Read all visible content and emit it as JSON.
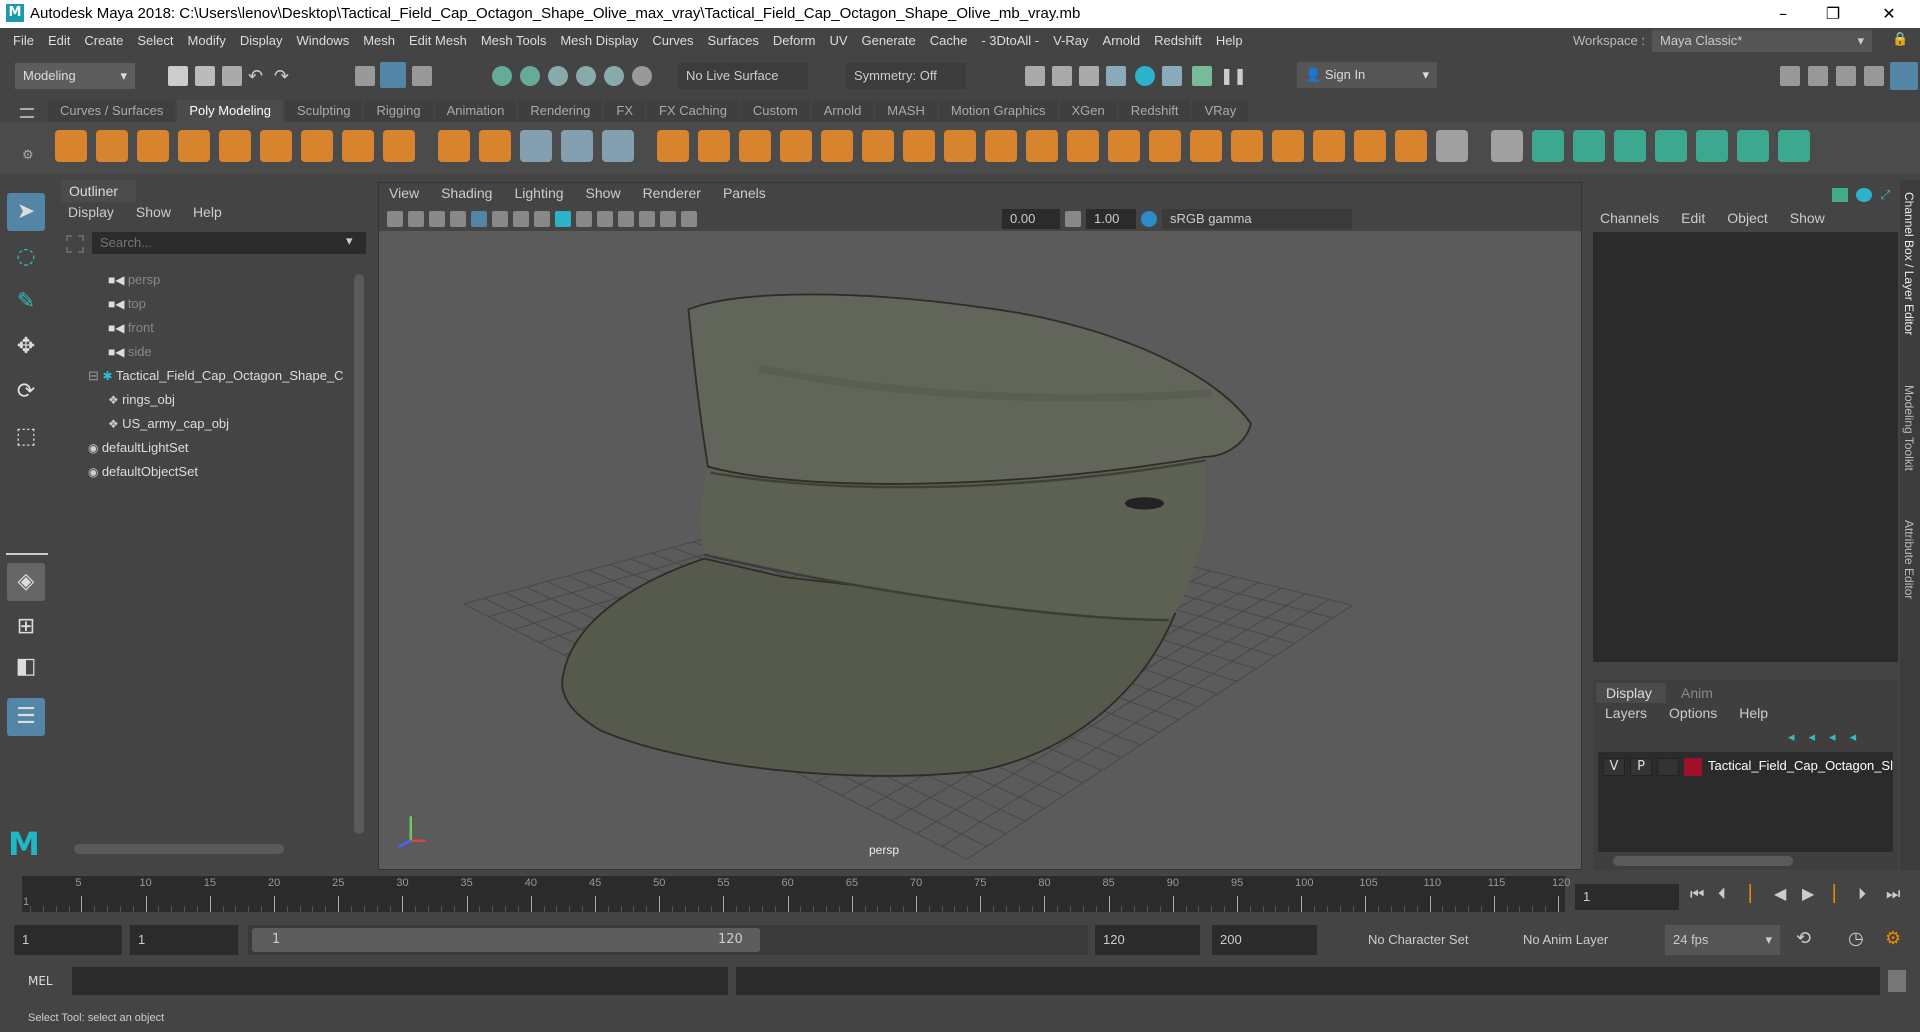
{
  "title": "Autodesk Maya 2018: C:\\Users\\lenov\\Desktop\\Tactical_Field_Cap_Octagon_Shape_Olive_max_vray\\Tactical_Field_Cap_Octagon_Shape_Olive_mb_vray.mb",
  "logo": "M",
  "window_controls": {
    "minimize": "–",
    "maximize": "❐",
    "close": "✕"
  },
  "menu": [
    "File",
    "Edit",
    "Create",
    "Select",
    "Modify",
    "Display",
    "Windows",
    "Mesh",
    "Edit Mesh",
    "Mesh Tools",
    "Mesh Display",
    "Curves",
    "Surfaces",
    "Deform",
    "UV",
    "Generate",
    "Cache",
    "- 3DtoAll -",
    "V-Ray",
    "Arnold",
    "Redshift",
    "Help"
  ],
  "workspace": {
    "label": "Workspace :",
    "value": "Maya Classic*"
  },
  "status": {
    "mode": "Modeling",
    "live_surface": "No Live Surface",
    "symmetry": "Symmetry: Off",
    "sign_in": "Sign In"
  },
  "shelf_tabs": [
    "Curves / Surfaces",
    "Poly Modeling",
    "Sculpting",
    "Rigging",
    "Animation",
    "Rendering",
    "FX",
    "FX Caching",
    "Custom",
    "Arnold",
    "MASH",
    "Motion Graphics",
    "XGen",
    "Redshift",
    "VRay"
  ],
  "shelf_active": "Poly Modeling",
  "shelf_icons": [
    "sphere",
    "cube",
    "cylinder",
    "cone",
    "torus",
    "plane",
    "disc",
    "platonic",
    "superellipse",
    "type",
    "svg",
    "sculpt",
    "uv",
    "snowflake",
    "combine",
    "separate",
    "extract",
    "smooth",
    "boolean",
    "mirror",
    "bevel",
    "bridge",
    "extrude",
    "append",
    "fill-hole",
    "multicut",
    "merge",
    "target-weld",
    "collapse",
    "quad-draw",
    "edge-loop",
    "offset-loop",
    "insert-edge",
    "pipe",
    "paint",
    "uv-layout",
    "planar",
    "cylindrical",
    "spherical",
    "auto-uv",
    "unfold",
    "cut-sew"
  ],
  "outliner": {
    "title": "Outliner",
    "menu": [
      "Display",
      "Show",
      "Help"
    ],
    "search_placeholder": "Search...",
    "items": [
      {
        "label": "persp",
        "type": "camera"
      },
      {
        "label": "top",
        "type": "camera"
      },
      {
        "label": "front",
        "type": "camera"
      },
      {
        "label": "side",
        "type": "camera"
      },
      {
        "label": "Tactical_Field_Cap_Octagon_Shape_C",
        "type": "group"
      },
      {
        "label": "rings_obj",
        "type": "mesh"
      },
      {
        "label": "US_army_cap_obj",
        "type": "mesh"
      },
      {
        "label": "defaultLightSet",
        "type": "set"
      },
      {
        "label": "defaultObjectSet",
        "type": "set"
      }
    ]
  },
  "viewport": {
    "menu": [
      "View",
      "Shading",
      "Lighting",
      "Show",
      "Renderer",
      "Panels"
    ],
    "exposure": "0.00",
    "gamma": "1.00",
    "color_space": "sRGB gamma",
    "camera": "persp"
  },
  "channel_box": {
    "menu": [
      "Channels",
      "Edit",
      "Object",
      "Show"
    ],
    "side_tabs": [
      "Channel Box / Layer Editor",
      "Modeling Toolkit",
      "Attribute Editor"
    ]
  },
  "layer_editor": {
    "tabs": [
      "Display",
      "Anim"
    ],
    "menu": [
      "Layers",
      "Options",
      "Help"
    ],
    "layer": {
      "v": "V",
      "p": "P",
      "name": "Tactical_Field_Cap_Octagon_Sl",
      "color": "#a0102a"
    }
  },
  "timeline": {
    "start": 1,
    "end": 120,
    "step": 5,
    "current": "1"
  },
  "range": {
    "start": "1",
    "inner_start": "1",
    "slider_start": "1",
    "slider_end": "120",
    "end": "120",
    "anim_end": "200",
    "character_set": "No Character Set",
    "anim_layer": "No Anim Layer",
    "fps": "24 fps"
  },
  "mel": {
    "label": "MEL"
  },
  "help_line": "Select Tool: select an object"
}
